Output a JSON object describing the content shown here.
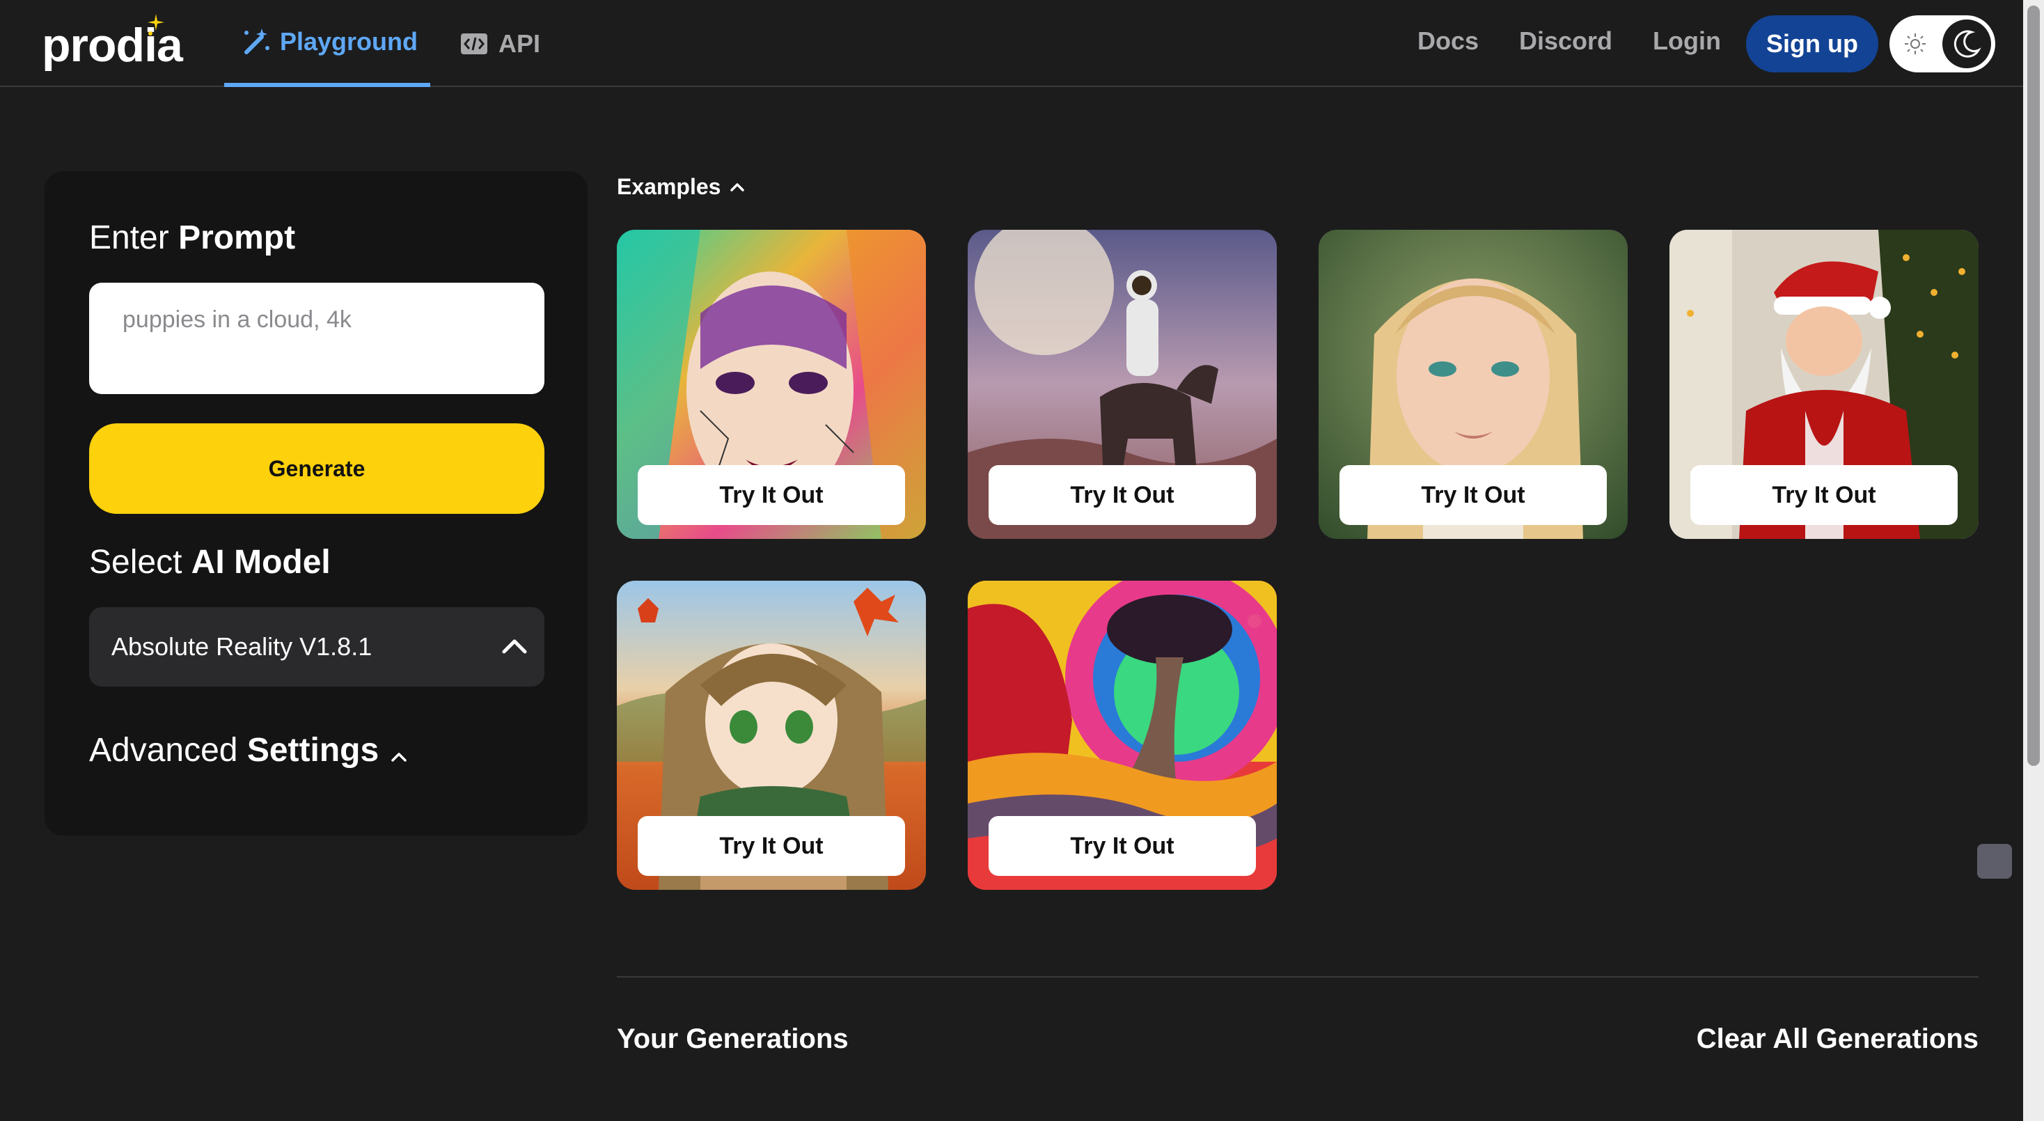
{
  "header": {
    "logo": "prodia",
    "tabs": [
      {
        "label": "Playground",
        "icon": "magic-wand-icon",
        "active": true
      },
      {
        "label": "API",
        "icon": "code-icon",
        "active": false
      }
    ],
    "links": [
      "Docs",
      "Discord",
      "Login"
    ],
    "signup_label": "Sign up",
    "theme_toggle": {
      "mode": "dark",
      "icons": [
        "sun-icon",
        "moon-icon"
      ]
    }
  },
  "left_panel": {
    "prompt_heading": {
      "light": "Enter ",
      "bold": "Prompt"
    },
    "prompt_placeholder": "puppies in a cloud, 4k",
    "generate_label": "Generate",
    "model_heading": {
      "light": "Select ",
      "bold": "AI Model"
    },
    "model_selected": "Absolute Reality V1.8.1",
    "advanced_heading": {
      "light": "Advanced ",
      "bold": "Settings"
    }
  },
  "examples": {
    "label": "Examples",
    "cards": [
      {
        "subject": "colorful painted woman portrait",
        "button": "Try It Out"
      },
      {
        "subject": "astronaut riding horse",
        "button": "Try It Out"
      },
      {
        "subject": "blonde woman portrait",
        "button": "Try It Out"
      },
      {
        "subject": "santa claus by tree",
        "button": "Try It Out"
      },
      {
        "subject": "anime girl in autumn",
        "button": "Try It Out"
      },
      {
        "subject": "psychedelic landscape tree",
        "button": "Try It Out"
      }
    ]
  },
  "generations": {
    "title": "Your Generations",
    "clear_label": "Clear All Generations"
  },
  "colors": {
    "background": "#1c1c1d",
    "panel": "#141415",
    "accent_blue": "#5fa8f5",
    "signup_bg": "#134394",
    "generate_bg": "#fdd10b"
  }
}
